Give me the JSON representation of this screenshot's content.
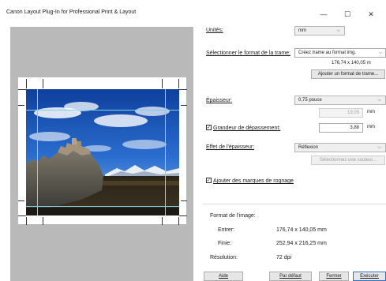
{
  "window": {
    "title": "Canon Layout Plug-In for Professional Print & Layout",
    "minimize_glyph": "—",
    "maximize_glyph": "☐",
    "close_glyph": "✕"
  },
  "settings": {
    "units_label": "Unités:",
    "units_value": "mm",
    "format_label": "Sélectionner le format de la trame:",
    "format_value": "Créez trame au format img.",
    "format_size": "176,74 x 140,05 m",
    "add_format_button": "Ajouter un format de trame...",
    "thickness_label": "Épaisseur:",
    "thickness_value": "0,75 pouce",
    "thickness_mm": "19,05",
    "thickness_unit": "mm",
    "overflow_label": "Grandeur de dépassement:",
    "overflow_value": "3,88",
    "overflow_unit": "mm",
    "overflow_checked": true,
    "effect_label": "Effet de l'épaisseur:",
    "effect_value": "Réflexion",
    "color_button": "Sélectionnez une couleur...",
    "crop_marks_label": "Ajouter des marques de rognage",
    "crop_marks_checked": true
  },
  "image_format": {
    "heading": "Format de l'image:",
    "input_label": "Entrer:",
    "input_value": "176,74 x 140,05 mm",
    "finish_label": "Finie:",
    "finish_value": "252,94 x 216,25 mm",
    "resolution_label": "Résolution:",
    "resolution_value": "72 dpi"
  },
  "footer": {
    "help": "Aide",
    "default": "Par défaut",
    "close": "Fermer",
    "execute": "Exécuter"
  },
  "icons": {
    "chevron": "chevron-down-icon",
    "check": "check-icon"
  }
}
